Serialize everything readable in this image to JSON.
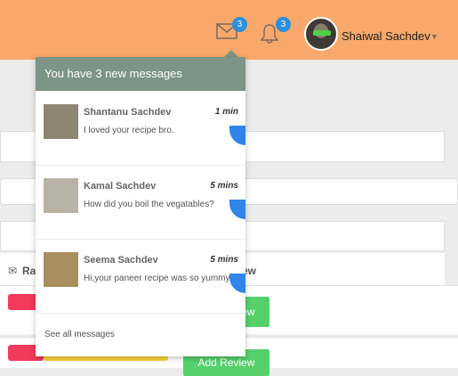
{
  "header": {
    "messages_badge": "3",
    "notifications_badge": "3",
    "user_name": "Shaiwal Sachdev"
  },
  "background": {
    "rating_label": "Ra",
    "add_review_header": "Add Review",
    "add_review_buttons": [
      "Add Review",
      "Add Review"
    ]
  },
  "dropdown": {
    "title": "You have 3 new messages",
    "messages": [
      {
        "sender": "Shantanu Sachdev",
        "time": "1 min",
        "text": "I loved your recipe bro."
      },
      {
        "sender": "Kamal Sachdev",
        "time": "5 mins",
        "text": "How did you boil the vegatables?"
      },
      {
        "sender": "Seema Sachdev",
        "time": "5 mins",
        "text": "Hi,your paneer recipe was so yummy"
      }
    ],
    "see_all": "See all messages"
  },
  "colors": {
    "topbar": "#f7a86a",
    "dropdown_header": "#7d9486",
    "badge": "#2d8fd9",
    "review_button": "#56d06c"
  }
}
